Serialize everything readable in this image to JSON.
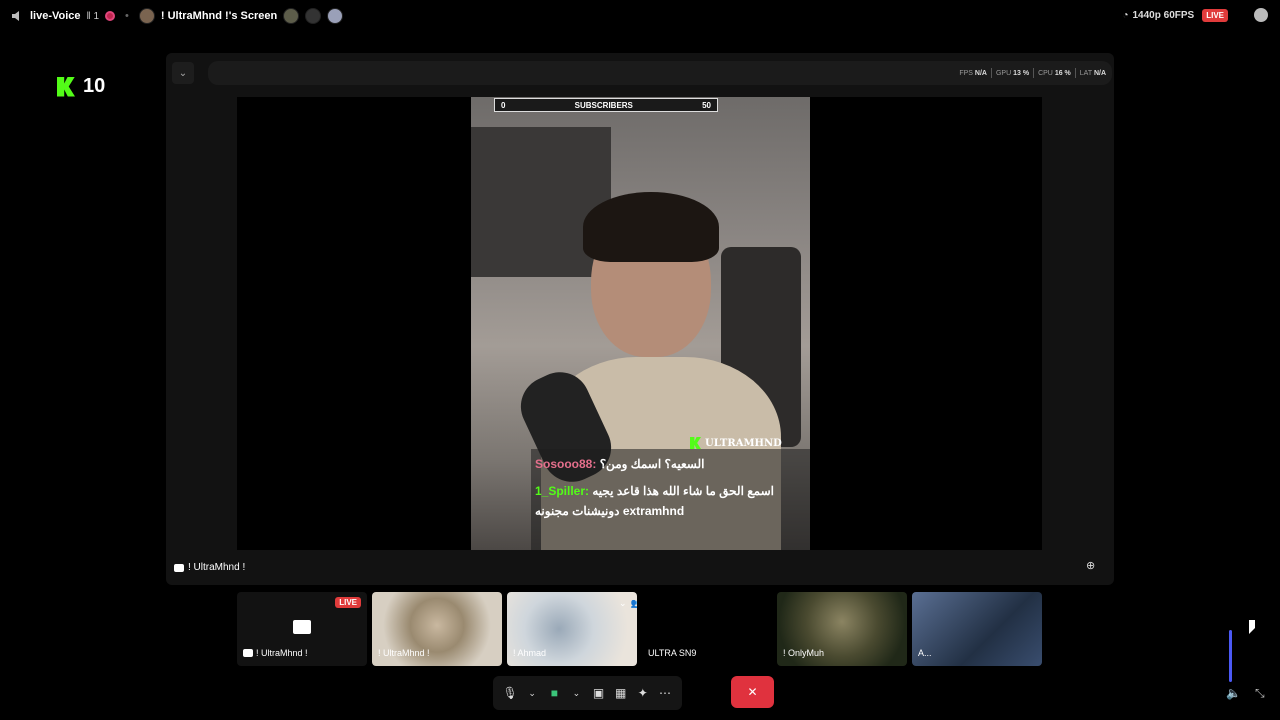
{
  "topbar": {
    "channel_title": "live-Voice",
    "channel_count": "‖ 1",
    "screen_label": "! UltraMhnd !'s Screen",
    "quality": "1440p 60FPS",
    "live": "LIVE"
  },
  "overlay_logo": {
    "count": "10"
  },
  "stats": {
    "fps_label": "FPS",
    "fps_value": "N/A",
    "gpu_label": "GPU",
    "gpu_value": "13 %",
    "cpu_label": "CPU",
    "cpu_value": "16 %",
    "lat_label": "LAT",
    "lat_value": "N/A"
  },
  "stream": {
    "subs_min": "0",
    "subs_label": "SUBSCRIBERS",
    "subs_max": "50",
    "chat_channel": "ULTRAMHND",
    "messages": [
      {
        "user": "Sosooo88:",
        "text": "السعيه؟ اسمك ومن؟"
      },
      {
        "user": "1_Spiller:",
        "text": "اسمع الحق ما شاء الله هذا قاعد يجيه"
      },
      {
        "user": "",
        "text": "دونيشنات مجنونه extramhnd"
      }
    ]
  },
  "stage": {
    "owner_label": "! UltraMhnd !"
  },
  "tiles": [
    {
      "label": "! UltraMhnd !",
      "live": "LIVE"
    },
    {
      "label": "! UltraMhnd !"
    },
    {
      "label": "! Ahmad"
    },
    {
      "label": "ULTRA SN9"
    },
    {
      "label": "! OnlyMuh"
    },
    {
      "label": "A..."
    }
  ],
  "colors": {
    "accent": "#53fc18",
    "live": "#e03b3b",
    "leave": "#e0323e",
    "volume": "#4b59f5"
  }
}
